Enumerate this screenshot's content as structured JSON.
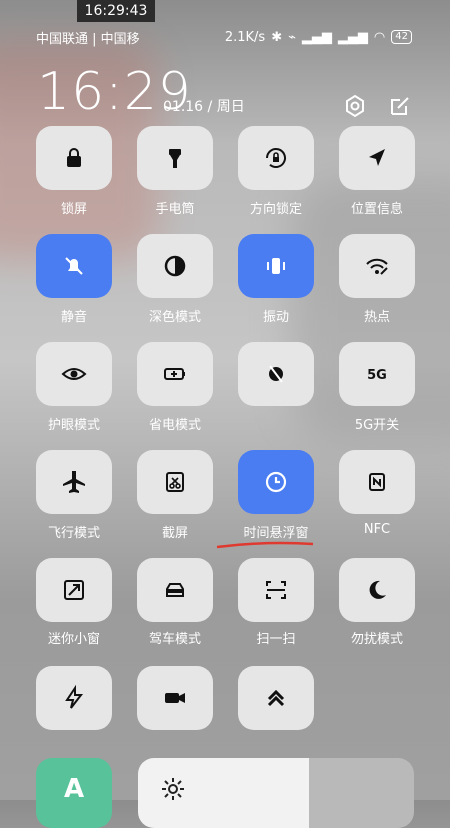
{
  "overlay": {
    "clock": "16:29:43"
  },
  "status_bar": {
    "carriers": "中国联通 | 中国移",
    "speed": "2.1K/s",
    "battery": "42"
  },
  "header": {
    "time": "16:29",
    "date": "01.16 / 周日"
  },
  "tiles": [
    {
      "label": "锁屏",
      "active": false,
      "icon": "lock-icon"
    },
    {
      "label": "手电筒",
      "active": false,
      "icon": "flashlight-icon"
    },
    {
      "label": "方向锁定",
      "active": false,
      "icon": "rotation-lock-icon"
    },
    {
      "label": "位置信息",
      "active": false,
      "icon": "location-arrow-icon"
    },
    {
      "label": "静音",
      "active": true,
      "icon": "bell-off-icon"
    },
    {
      "label": "深色模式",
      "active": false,
      "icon": "dark-mode-icon"
    },
    {
      "label": "振动",
      "active": true,
      "icon": "vibrate-icon"
    },
    {
      "label": "热点",
      "active": false,
      "icon": "wifi-hotspot-icon"
    },
    {
      "label": "护眼模式",
      "active": false,
      "icon": "eye-icon"
    },
    {
      "label": "省电模式",
      "active": false,
      "icon": "battery-saver-icon"
    },
    {
      "label": "",
      "active": false,
      "icon": "ball-crossed-icon"
    },
    {
      "label": "5G开关",
      "active": false,
      "icon": "5g-icon"
    },
    {
      "label": "飞行模式",
      "active": false,
      "icon": "airplane-icon"
    },
    {
      "label": "截屏",
      "active": false,
      "icon": "screenshot-icon"
    },
    {
      "label": "时间悬浮窗",
      "active": true,
      "icon": "clock-icon"
    },
    {
      "label": "NFC",
      "active": false,
      "icon": "nfc-icon"
    },
    {
      "label": "迷你小窗",
      "active": false,
      "icon": "mini-window-icon"
    },
    {
      "label": "驾车模式",
      "active": false,
      "icon": "car-icon"
    },
    {
      "label": "扫一扫",
      "active": false,
      "icon": "scan-icon"
    },
    {
      "label": "勿扰模式",
      "active": false,
      "icon": "moon-icon"
    },
    {
      "label": "",
      "active": false,
      "icon": "bolt-icon"
    },
    {
      "label": "",
      "active": false,
      "icon": "video-camera-icon"
    },
    {
      "label": "",
      "active": false,
      "icon": "double-chevron-up-icon"
    }
  ],
  "app_tile": {
    "letter": "A"
  },
  "colors": {
    "active": "#4a7df2",
    "tile": "#e6e6e6",
    "app": "#58c39a",
    "underline": "#e0392f"
  }
}
